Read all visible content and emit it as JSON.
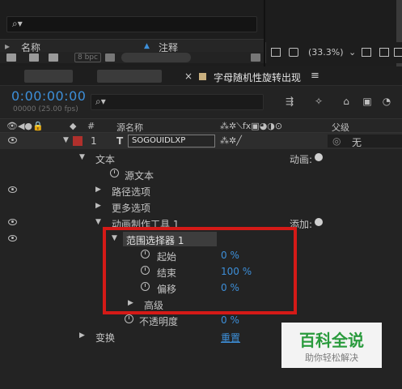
{
  "project_panel": {
    "col_name": "名称",
    "col_comment": "注释",
    "bpc": "8 bpc"
  },
  "viewer": {
    "zoom": "(33.3%)"
  },
  "timeline": {
    "comp_tab": "字母随机性旋转出现",
    "timecode": "0:00:00:00",
    "timecode_sub": "00000 (25.00 fps)"
  },
  "columns": {
    "index": "#",
    "source_name": "源名称",
    "parent": "父级"
  },
  "layer": {
    "index": "1",
    "type_icon": "T",
    "name": "SOGOUIDLXP",
    "parent_value": "无"
  },
  "properties": {
    "text": "文本",
    "text_right": "动画:",
    "source_text": "源文本",
    "path_options": "路径选项",
    "more_options": "更多选项",
    "animator": "动画制作工具 1",
    "animator_right": "添加:",
    "range_selector": "范围选择器 1",
    "start": "起始",
    "start_value": "0 %",
    "end": "结束",
    "end_value": "100 %",
    "offset": "偏移",
    "offset_value": "0 %",
    "advanced": "高级",
    "opacity": "不透明度",
    "opacity_value": "0 %",
    "transform": "变换",
    "reset": "重置"
  },
  "watermark": {
    "main": "百科全说",
    "sub": "助你轻松解决"
  },
  "colors": {
    "accent_blue": "#3d8fd9",
    "highlight_red": "#d41a17",
    "label_red": "#b0302c",
    "watermark_green": "#2a9b3d"
  }
}
